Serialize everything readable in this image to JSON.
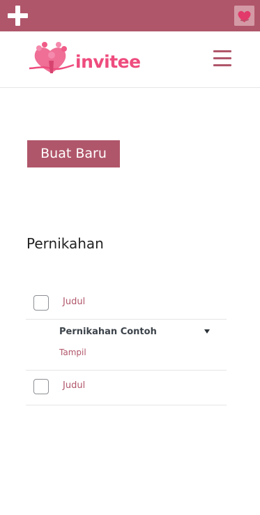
{
  "topbar": {
    "add_icon": "plus-icon",
    "avatar_icon": "heart-avatar-icon"
  },
  "header": {
    "logo_text": "invitee",
    "menu_icon": "hamburger-menu-icon"
  },
  "main": {
    "create_button_label": "Buat Baru",
    "section_title": "Pernikahan",
    "list": {
      "header_label": "Judul",
      "footer_label": "Judul",
      "items": [
        {
          "title": "Pernikahan Contoh",
          "action": "Tampil"
        }
      ]
    }
  },
  "colors": {
    "brand": "#b0566a",
    "logo_pink": "#ee4c7e"
  }
}
